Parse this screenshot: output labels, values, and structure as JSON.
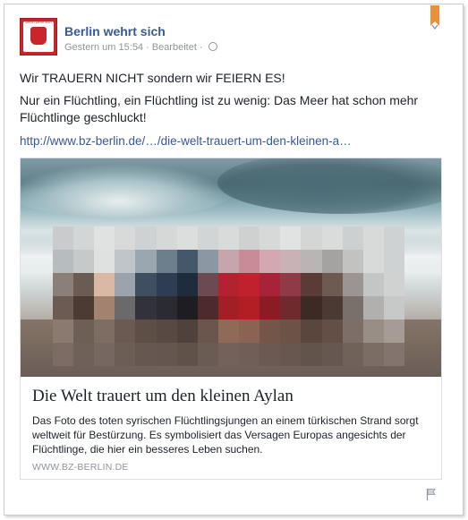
{
  "post": {
    "page_name": "Berlin wehrt sich",
    "timestamp": "Gestern um 15:54",
    "edited": "Bearbeitet",
    "avatar_text": "Berlin wehrt sich",
    "text_line1": "Wir TRAUERN NICHT sondern wir FEIERN ES!",
    "text_line2": "Nur ein Flüchtling, ein Flüchtling ist zu wenig: Das Meer hat schon mehr Flüchtlinge geschluckt!",
    "link_text": "http://www.bz-berlin.de/…/die-welt-trauert-um-den-kleinen-a…"
  },
  "card": {
    "title": "Die Welt trauert um den kleinen Aylan",
    "description": "Das Foto des toten syrischen Flüchtlingsjungen an einem türkischen Strand sorgt weltweit für Bestürzung. Es symbolisiert das Versagen Europas angesichts der Flüchtlinge, die hier ein besseres Leben suchen.",
    "domain": "WWW.BZ-BERLIN.DE"
  },
  "icons": {
    "bookmark": "bookmark-icon",
    "chevron": "chevron-down-icon",
    "globe": "globe-icon",
    "flag": "flag-icon"
  },
  "colors": {
    "link": "#365899",
    "page_name": "#3b5998",
    "bookmark": "#e8913a",
    "avatar": "#c8262b"
  }
}
